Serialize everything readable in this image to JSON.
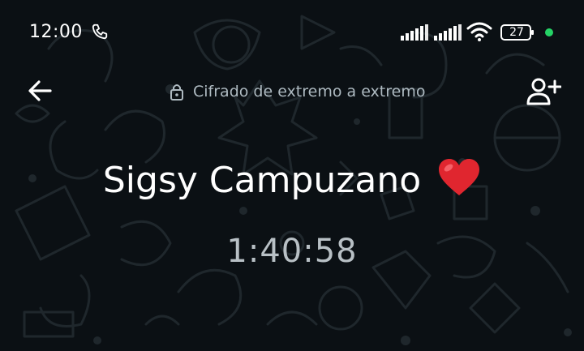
{
  "status_bar": {
    "time": "12:00",
    "battery_level": "27",
    "icons": [
      "phone-icon",
      "signal-icon",
      "signal-icon",
      "wifi-icon",
      "battery-icon"
    ],
    "charge_dot_color": "#25d366"
  },
  "call": {
    "encryption_label": "Cifrado de extremo a extremo",
    "contact_name": "Sigsy Campuzano",
    "duration": "1:40:58",
    "icons": [
      "back-arrow-icon",
      "lock-icon",
      "add-participant-icon",
      "heart-icon"
    ]
  },
  "theme": {
    "background": "#0b1014",
    "doodle_color": "#1f262b",
    "heart": "#e0262f"
  }
}
